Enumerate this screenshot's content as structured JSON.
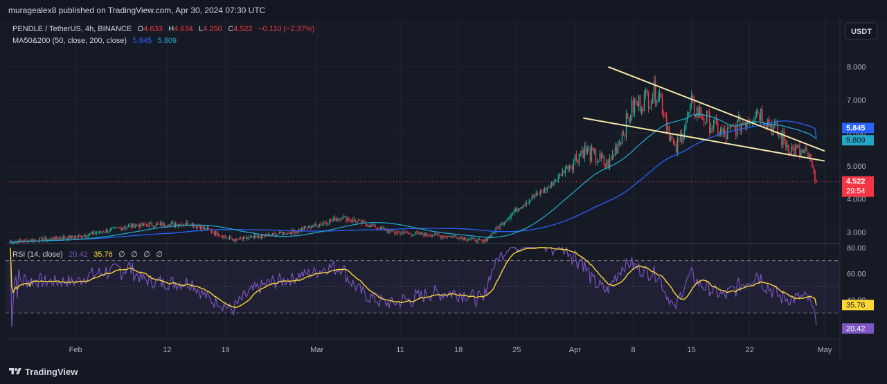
{
  "publish": {
    "text": "muragealex8 published on TradingView.com, Apr 30, 2024 07:30 UTC"
  },
  "legend": {
    "symbol": "PENDLE / TetherUS, 4h, BINANCE",
    "o_label": "O",
    "o": "4.633",
    "h_label": "H",
    "h": "4.634",
    "l_label": "L",
    "l": "4.250",
    "c_label": "C",
    "c": "4.522",
    "change": "−0.110 (−2.37%)",
    "ma_label": "MA50&200 (50, close, 200, close)",
    "ma50": "5.845",
    "ma200": "5.809"
  },
  "rsi_legend": {
    "label": "RSI (14, close)",
    "rsi": "20.42",
    "ma": "35.76",
    "extras": [
      "∅",
      "∅",
      "∅",
      "∅"
    ]
  },
  "currency_button": "USDT",
  "badges": {
    "ma50": "5.845",
    "ma200": "5.809",
    "price": "4.522",
    "countdown": "29:54",
    "rsi_ma": "35.76",
    "rsi": "20.42"
  },
  "footer": {
    "brand": "TradingView"
  },
  "colors": {
    "background": "#161a25",
    "up": "#22ab94",
    "down": "#f23645",
    "ma50": "#2962ff",
    "ma200": "#22a6c8",
    "trendline": "#f5e6a8",
    "rsi": "#7e57c2",
    "rsi_ma": "#fdd835"
  },
  "chart_data": [
    {
      "type": "candlestick",
      "title": "PENDLE / TetherUS, 4h, BINANCE",
      "y_ticks": [
        "8.000",
        "7.000",
        "6.000",
        "5.000",
        "4.000",
        "3.000"
      ],
      "x_ticks": [
        "Feb",
        "12",
        "19",
        "Mar",
        "11",
        "18",
        "25",
        "Apr",
        "8",
        "15",
        "22",
        "May"
      ],
      "ylim": [
        2.65,
        8.6
      ],
      "last_close": 4.522,
      "key_closes": [
        {
          "date": "2024-01-24",
          "close": 2.7
        },
        {
          "date": "2024-02-01",
          "close": 2.85
        },
        {
          "date": "2024-02-08",
          "close": 3.2
        },
        {
          "date": "2024-02-15",
          "close": 3.25
        },
        {
          "date": "2024-02-20",
          "close": 2.75
        },
        {
          "date": "2024-02-27",
          "close": 3.0
        },
        {
          "date": "2024-03-04",
          "close": 3.45
        },
        {
          "date": "2024-03-10",
          "close": 3.0
        },
        {
          "date": "2024-03-18",
          "close": 2.85
        },
        {
          "date": "2024-03-21",
          "close": 2.7
        },
        {
          "date": "2024-03-25",
          "close": 3.7
        },
        {
          "date": "2024-03-29",
          "close": 4.4
        },
        {
          "date": "2024-04-02",
          "close": 5.5
        },
        {
          "date": "2024-04-05",
          "close": 5.0
        },
        {
          "date": "2024-04-08",
          "close": 6.8
        },
        {
          "date": "2024-04-11",
          "close": 7.3
        },
        {
          "date": "2024-04-13",
          "close": 5.4
        },
        {
          "date": "2024-04-15",
          "close": 6.8
        },
        {
          "date": "2024-04-19",
          "close": 5.9
        },
        {
          "date": "2024-04-23",
          "close": 6.7
        },
        {
          "date": "2024-04-27",
          "close": 5.5
        },
        {
          "date": "2024-04-29",
          "close": 5.3
        },
        {
          "date": "2024-04-30",
          "close": 4.522
        }
      ],
      "series": [
        {
          "name": "MA 50",
          "last": 5.845
        },
        {
          "name": "MA 200",
          "last": 5.809
        }
      ],
      "trendlines": [
        {
          "from": {
            "date": "2024-04-05",
            "price": 8.0
          },
          "to": {
            "date": "2024-05-01",
            "price": 5.45
          }
        },
        {
          "from": {
            "date": "2024-04-02",
            "price": 6.45
          },
          "to": {
            "date": "2024-05-01",
            "price": 5.15
          }
        }
      ]
    },
    {
      "type": "line",
      "title": "RSI (14, close)",
      "y_ticks": [
        "80.00",
        "60.00",
        "40.00"
      ],
      "ylim": [
        10,
        82
      ],
      "bands": [
        70,
        50,
        30
      ],
      "series": [
        {
          "name": "RSI",
          "last": 20.42
        },
        {
          "name": "RSI MA",
          "last": 35.76
        }
      ]
    }
  ]
}
